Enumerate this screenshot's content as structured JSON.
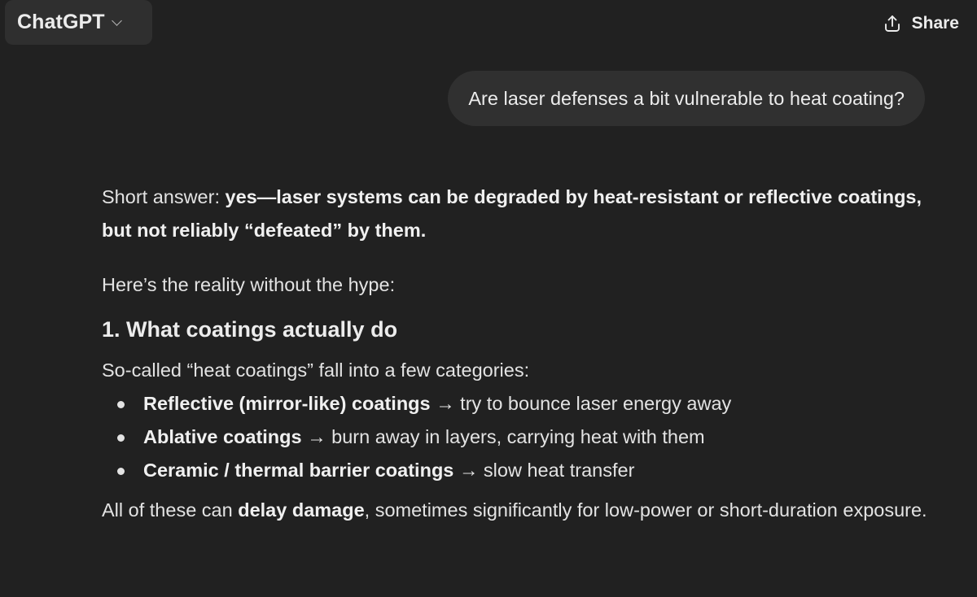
{
  "header": {
    "model_name": "ChatGPT",
    "model_chevron_icon": "chevron-down-icon",
    "share_label": "Share",
    "share_icon": "upload-share-icon"
  },
  "conversation": {
    "user_message": "Are laser defenses a bit vulnerable to heat coating?",
    "assistant": {
      "short_prefix": "Short answer: ",
      "short_bold": "yes—laser systems can be degraded by heat-resistant or reflective coatings, but not reliably “defeated” by them.",
      "reality": "Here’s the reality without the hype:",
      "section_heading": "1. What coatings actually do",
      "intro": "So-called “heat coatings” fall into a few categories:",
      "bullets": [
        {
          "bold": "Reflective (mirror-like) coatings",
          "rest": " → try to bounce laser energy away"
        },
        {
          "bold": "Ablative coatings",
          "rest": " → burn away in layers, carrying heat with them"
        },
        {
          "bold": "Ceramic / thermal barrier coatings",
          "rest": " → slow heat transfer"
        }
      ],
      "closing_prefix": "All of these can ",
      "closing_bold": "delay damage",
      "closing_rest": ", sometimes significantly for low-power or short-duration exposure."
    }
  },
  "colors": {
    "background": "#212121",
    "bubble": "#303030",
    "switcher": "#2f2f2f",
    "text": "#ececec"
  }
}
